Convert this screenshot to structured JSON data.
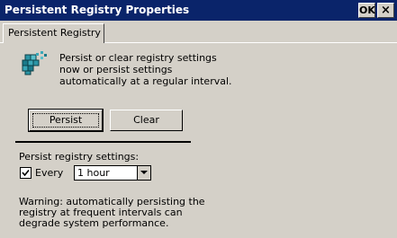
{
  "window": {
    "title": "Persistent Registry Properties",
    "ok_label": "OK",
    "close_label": "×"
  },
  "tabs": [
    {
      "label": "Persistent Registry",
      "active": true
    }
  ],
  "main": {
    "icon": "registry-icon",
    "intro_text": "Persist or clear registry settings now or persist settings automatically at a regular interval.",
    "persist_button": "Persist",
    "clear_button": "Clear",
    "settings_label": "Persist registry settings:",
    "every_checkbox": {
      "label": "Every",
      "checked": true
    },
    "interval_select": {
      "value": "1 hour"
    },
    "warning_text": "Warning: automatically persisting the registry at frequent intervals can degrade system performance."
  },
  "colors": {
    "titlebar": "#0a246a",
    "dialog_bg": "#d4d0c8"
  }
}
